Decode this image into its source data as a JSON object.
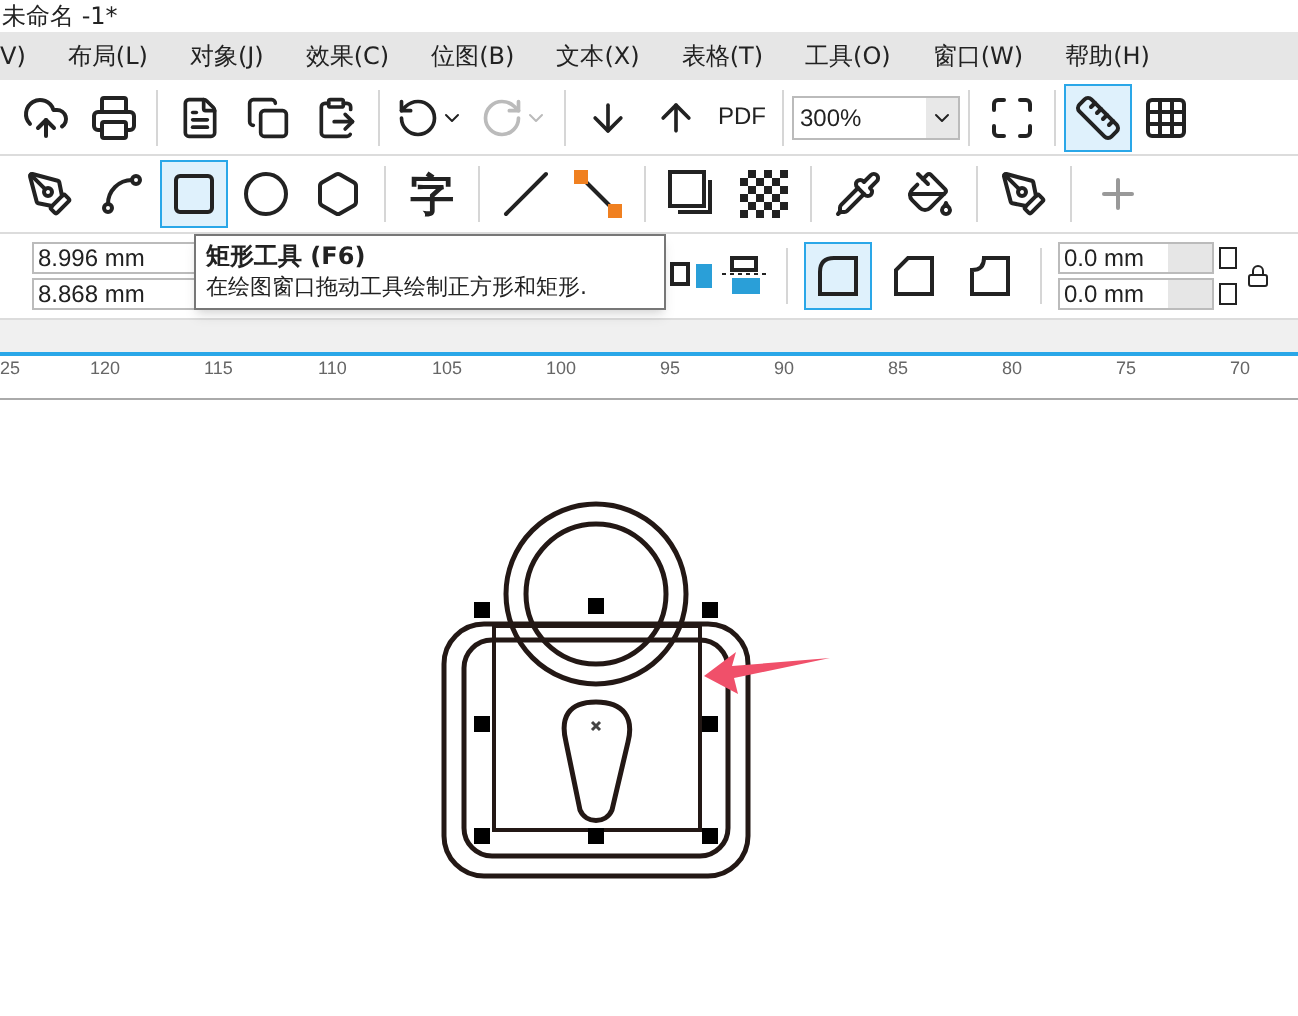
{
  "window": {
    "title": "未命名 -1*"
  },
  "menu": [
    "V)",
    "布局(L)",
    "对象(J)",
    "效果(C)",
    "位图(B)",
    "文本(X)",
    "表格(T)",
    "工具(O)",
    "窗口(W)",
    "帮助(H)"
  ],
  "standard_toolbar": {
    "pdf_label": "PDF",
    "redo_disabled": true,
    "zoom": "300%",
    "rulers_selected": true
  },
  "toolbox": {
    "tools": [
      {
        "selected": false
      },
      {
        "selected": false
      },
      {
        "selected": true
      },
      {
        "selected": false
      },
      {
        "selected": false
      },
      {
        "selected": false,
        "label": "字"
      },
      {
        "selected": false
      },
      {
        "selected": false
      },
      {
        "selected": false
      },
      {
        "selected": false
      },
      {
        "selected": false
      },
      {
        "selected": false
      },
      {
        "selected": false
      },
      {
        "selected": false
      }
    ]
  },
  "property_bar": {
    "width": "8.996 mm",
    "height": "8.868 mm",
    "corners": [
      {
        "selected": true
      },
      {
        "selected": false
      },
      {
        "selected": false
      }
    ],
    "corner_radius": [
      "0.0 mm",
      "0.0 mm"
    ]
  },
  "tooltip": {
    "title": "矩形工具 (F6)",
    "description": "在绘图窗口拖动工具绘制正方形和矩形."
  },
  "ruler": {
    "labels": [
      "25",
      "120",
      "115",
      "110",
      "105",
      "100",
      "95",
      "90",
      "85",
      "80",
      "75",
      "70"
    ]
  }
}
